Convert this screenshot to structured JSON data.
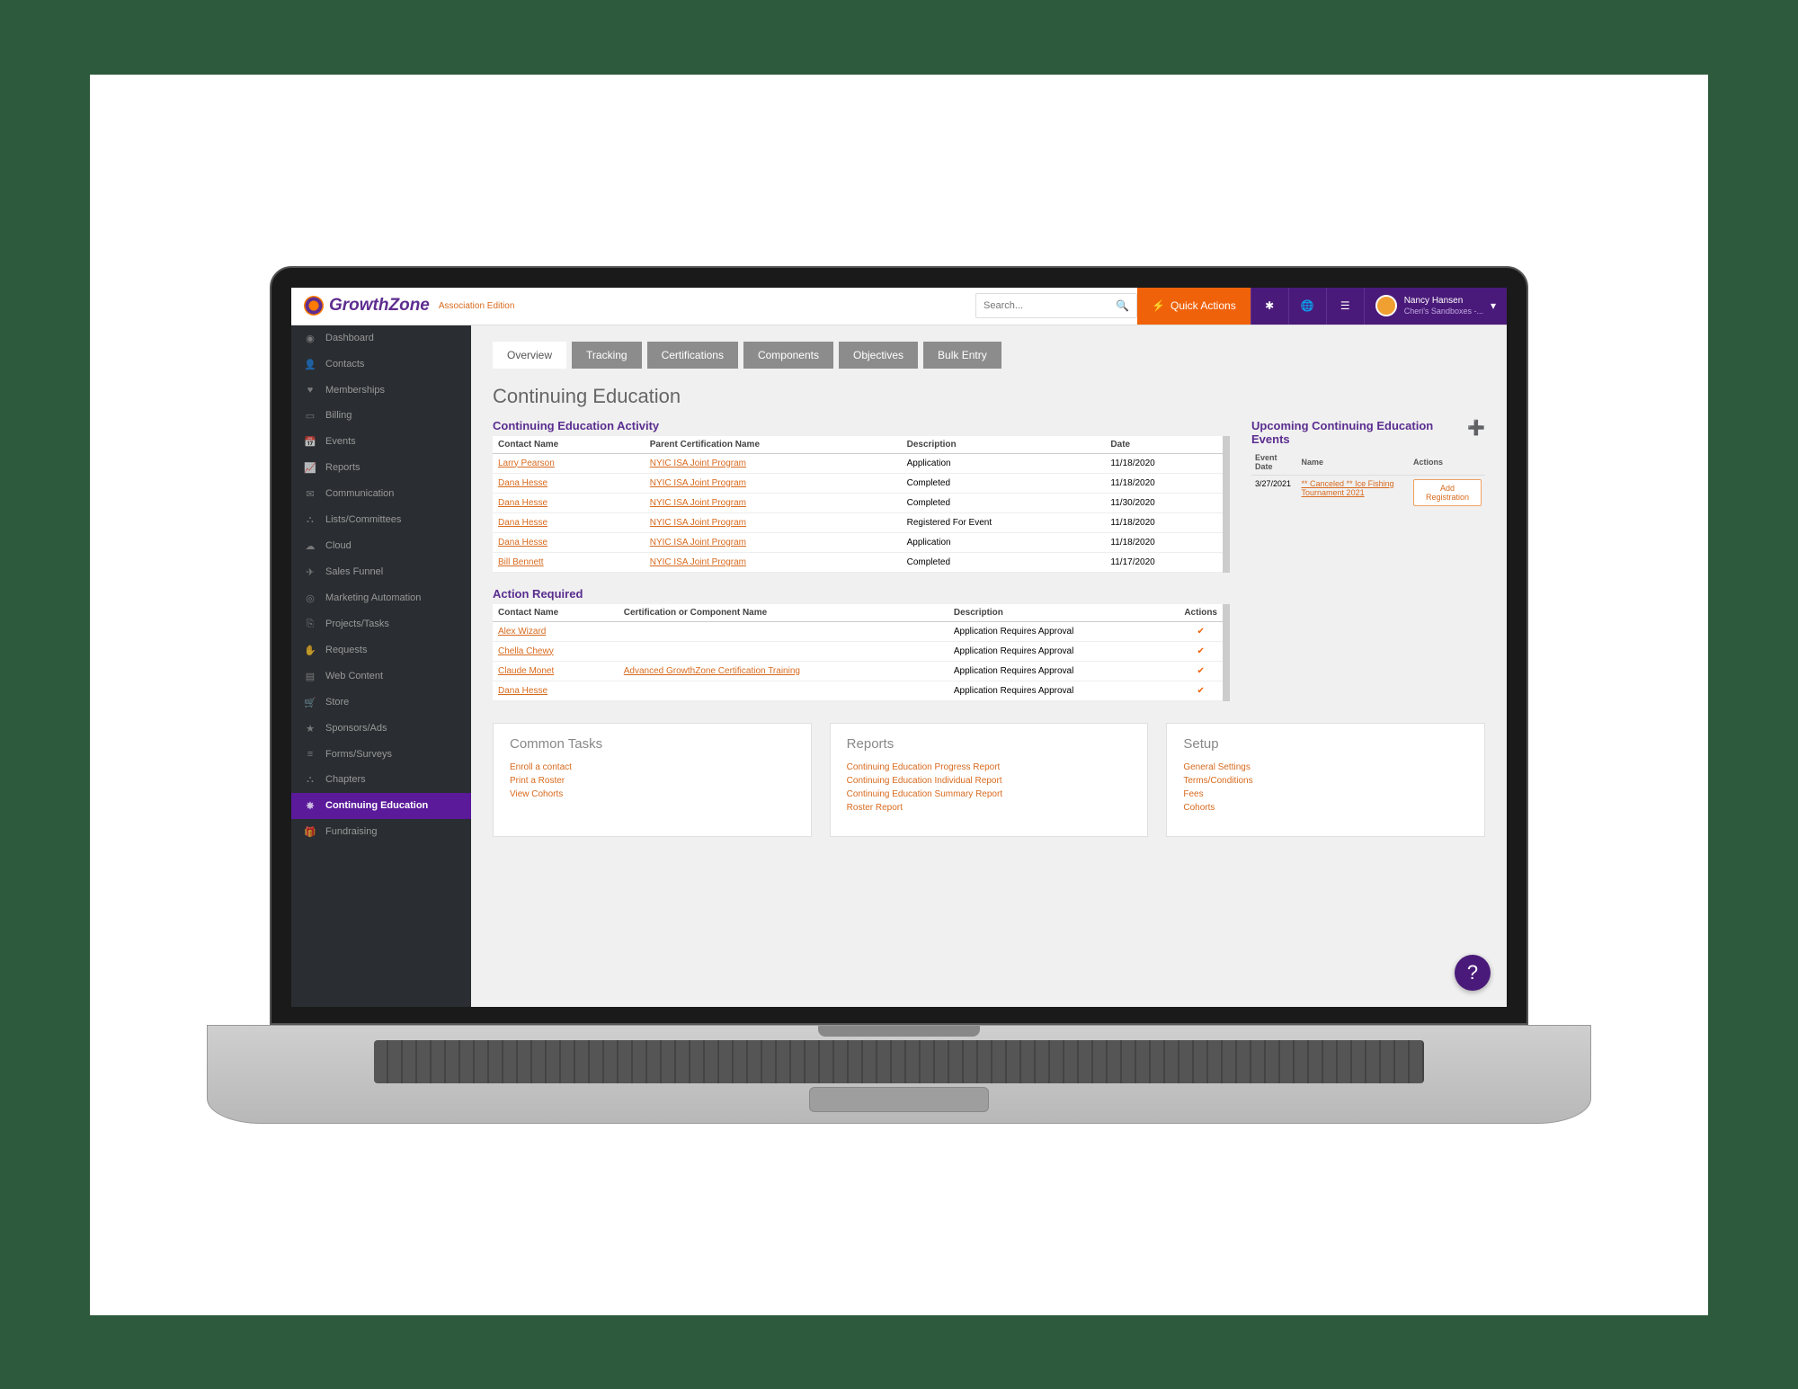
{
  "brand": {
    "name": "GrowthZone",
    "edition": "Association Edition"
  },
  "search": {
    "placeholder": "Search..."
  },
  "quick_actions": "Quick Actions",
  "user": {
    "name": "Nancy Hansen",
    "org": "Cheri's Sandboxes -..."
  },
  "sidebar": [
    {
      "icon": "◉",
      "label": "Dashboard"
    },
    {
      "icon": "👤",
      "label": "Contacts"
    },
    {
      "icon": "♥",
      "label": "Memberships"
    },
    {
      "icon": "▭",
      "label": "Billing"
    },
    {
      "icon": "📅",
      "label": "Events"
    },
    {
      "icon": "📈",
      "label": "Reports"
    },
    {
      "icon": "✉",
      "label": "Communication"
    },
    {
      "icon": "⛬",
      "label": "Lists/Committees"
    },
    {
      "icon": "☁",
      "label": "Cloud"
    },
    {
      "icon": "✈",
      "label": "Sales Funnel"
    },
    {
      "icon": "◎",
      "label": "Marketing Automation"
    },
    {
      "icon": "⎘",
      "label": "Projects/Tasks"
    },
    {
      "icon": "✋",
      "label": "Requests"
    },
    {
      "icon": "▤",
      "label": "Web Content"
    },
    {
      "icon": "🛒",
      "label": "Store"
    },
    {
      "icon": "★",
      "label": "Sponsors/Ads"
    },
    {
      "icon": "≡",
      "label": "Forms/Surveys"
    },
    {
      "icon": "⛬",
      "label": "Chapters"
    },
    {
      "icon": "✸",
      "label": "Continuing Education",
      "active": true
    },
    {
      "icon": "🎁",
      "label": "Fundraising"
    }
  ],
  "tabs": [
    "Overview",
    "Tracking",
    "Certifications",
    "Components",
    "Objectives",
    "Bulk Entry"
  ],
  "active_tab": "Overview",
  "page_title": "Continuing Education",
  "activity": {
    "title": "Continuing Education Activity",
    "headers": [
      "Contact Name",
      "Parent Certification Name",
      "Description",
      "Date"
    ],
    "rows": [
      {
        "contact": "Larry Pearson",
        "cert": "NYIC ISA Joint Program",
        "desc": "Application",
        "date": "11/18/2020"
      },
      {
        "contact": "Dana Hesse",
        "cert": "NYIC ISA Joint Program",
        "desc": "Completed",
        "date": "11/18/2020"
      },
      {
        "contact": "Dana Hesse",
        "cert": "NYIC ISA Joint Program",
        "desc": "Completed",
        "date": "11/30/2020"
      },
      {
        "contact": "Dana Hesse",
        "cert": "NYIC ISA Joint Program",
        "desc": "Registered For Event",
        "date": "11/18/2020"
      },
      {
        "contact": "Dana Hesse",
        "cert": "NYIC ISA Joint Program",
        "desc": "Application",
        "date": "11/18/2020"
      },
      {
        "contact": "Bill Bennett",
        "cert": "NYIC ISA Joint Program",
        "desc": "Completed",
        "date": "11/17/2020"
      }
    ]
  },
  "action_required": {
    "title": "Action Required",
    "headers": [
      "Contact Name",
      "Certification or Component Name",
      "Description",
      "Actions"
    ],
    "rows": [
      {
        "contact": "Alex Wizard",
        "cert": "",
        "desc": "Application Requires Approval"
      },
      {
        "contact": "Chella Chewy",
        "cert": "",
        "desc": "Application Requires Approval"
      },
      {
        "contact": "Claude Monet",
        "cert": "Advanced GrowthZone Certification Training",
        "desc": "Application Requires Approval"
      },
      {
        "contact": "Dana Hesse",
        "cert": "",
        "desc": "Application Requires Approval"
      }
    ]
  },
  "upcoming": {
    "title": "Upcoming Continuing Education Events",
    "headers": [
      "Event Date",
      "Name",
      "Actions"
    ],
    "rows": [
      {
        "date": "3/27/2021",
        "name": "** Canceled ** Ice Fishing Tournament 2021",
        "action": "Add Registration"
      }
    ]
  },
  "common_tasks": {
    "title": "Common Tasks",
    "links": [
      "Enroll a contact",
      "Print a Roster",
      "View Cohorts"
    ]
  },
  "reports_card": {
    "title": "Reports",
    "links": [
      "Continuing Education Progress Report",
      "Continuing Education Individual Report",
      "Continuing Education Summary Report",
      "Roster Report"
    ]
  },
  "setup_card": {
    "title": "Setup",
    "links": [
      "General Settings",
      "Terms/Conditions",
      "Fees",
      "Cohorts"
    ]
  }
}
